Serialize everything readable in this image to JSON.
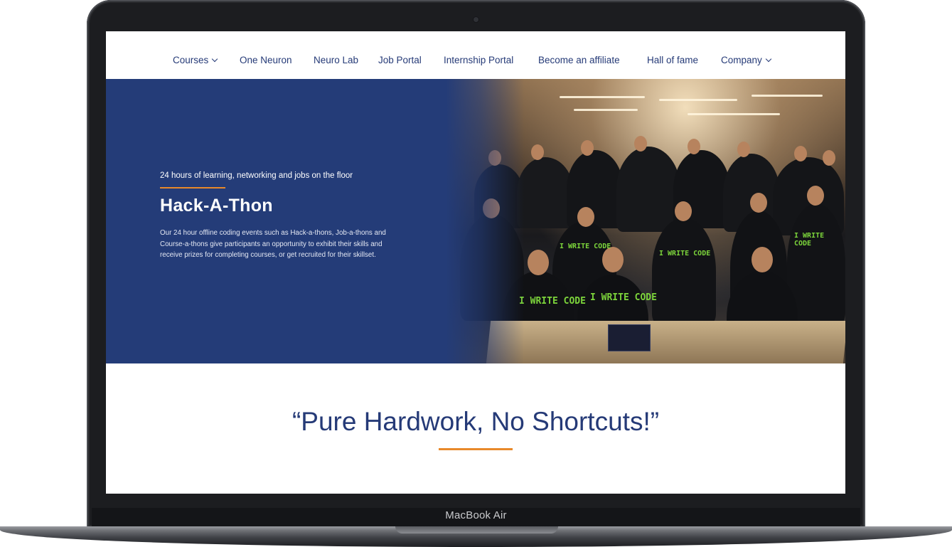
{
  "nav": {
    "items": [
      {
        "label": "Courses",
        "dropdown": true
      },
      {
        "label": "One Neuron",
        "dropdown": false
      },
      {
        "label": "Neuro Lab",
        "dropdown": false
      },
      {
        "label": "Job Portal",
        "dropdown": false
      },
      {
        "label": "Internship Portal",
        "dropdown": false
      },
      {
        "label": "Become an affiliate",
        "dropdown": false
      },
      {
        "label": "Hall of fame",
        "dropdown": false
      },
      {
        "label": "Company",
        "dropdown": true
      }
    ]
  },
  "hero": {
    "eyebrow": "24 hours of learning, networking and jobs on the floor",
    "title": "Hack-A-Thon",
    "body": "Our 24 hour offline coding events such as Hack-a-thons, Job-a-thons and Course-a-thons give participants an opportunity to exhibit their skills and receive prizes for completing courses, or get recruited for their skillset.",
    "photo_shirt_text": [
      "I WRITE CODE",
      "I WRITE CODE",
      "I WRITE CODE",
      "I WRITE CODE",
      "I WRITE CODE"
    ]
  },
  "quote": {
    "text": "“Pure Hardwork, No Shortcuts!”"
  },
  "device": {
    "label": "MacBook Air"
  },
  "colors": {
    "brand_blue": "#243c78",
    "nav_text": "#253a77",
    "accent_orange": "#e8892a"
  }
}
